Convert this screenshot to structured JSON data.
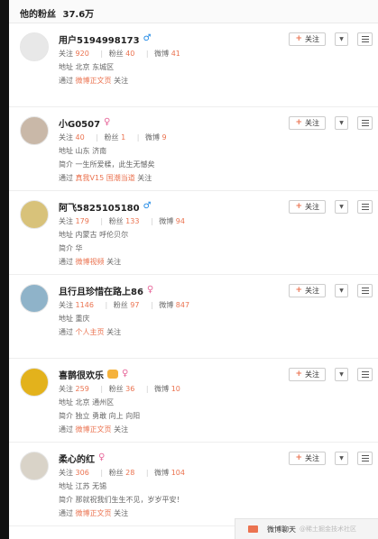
{
  "header": {
    "title": "他的粉丝",
    "count": "37.6万"
  },
  "colors": {
    "accent": "#eb7350",
    "male": "#1e88e5",
    "female": "#e7689b"
  },
  "labels": {
    "follow_btn": "关注",
    "following": "关注",
    "fans": "粉丝",
    "weibo": "微博",
    "location": "地址",
    "bio": "简介",
    "via": "通过",
    "via_suffix": "关注"
  },
  "users": [
    {
      "name": "用户5194998173",
      "gender": "male",
      "following": "920",
      "fans": "40",
      "weibo": "41",
      "location": "北京 东城区",
      "bio": "",
      "via_source": "微博正文页"
    },
    {
      "name": "小G0507",
      "gender": "female",
      "following": "40",
      "fans": "1",
      "weibo": "9",
      "location": "山东 济南",
      "bio": "一生所爱糅，此生无憾矣",
      "via_source": "真我V15 国潮当道"
    },
    {
      "name": "阿飞5825105180",
      "gender": "male",
      "following": "179",
      "fans": "133",
      "weibo": "94",
      "location": "内蒙古 呼伦贝尔",
      "bio": "华",
      "via_source": "微博视频"
    },
    {
      "name": "且行且珍惜在路上86",
      "gender": "female",
      "following": "1146",
      "fans": "97",
      "weibo": "847",
      "location": "重庆",
      "bio": "",
      "via_source": "个人主页"
    },
    {
      "name": "喜鹊很欢乐",
      "gender": "female",
      "following": "259",
      "fans": "36",
      "weibo": "10",
      "location": "北京 通州区",
      "bio": "独立 勇敢 向上 向阳",
      "via_source": "微博正文页"
    },
    {
      "name": "柔心的红",
      "gender": "female",
      "following": "306",
      "fans": "28",
      "weibo": "104",
      "location": "江苏 无锡",
      "bio": "那就祝我们生生不见，岁岁平安！",
      "via_source": "微博正文页"
    }
  ],
  "chat": {
    "label": "微博聊天",
    "watermark": "@稀土掘金技术社区"
  }
}
